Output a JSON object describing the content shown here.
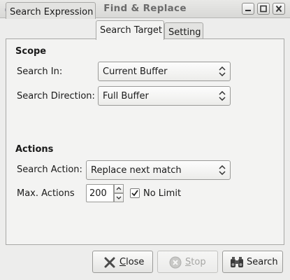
{
  "window": {
    "title": "Find & Replace"
  },
  "tabs": [
    {
      "label": "Search Expression",
      "active": false
    },
    {
      "label": "Search Target",
      "active": true
    },
    {
      "label": "Setting",
      "active": false
    }
  ],
  "scope": {
    "heading": "Scope",
    "search_in_label": "Search In:",
    "search_in_value": "Current Buffer",
    "direction_label": "Search Direction:",
    "direction_value": "Full Buffer"
  },
  "actions": {
    "heading": "Actions",
    "search_action_label": "Search Action:",
    "search_action_value": "Replace next match",
    "max_actions_label": "Max. Actions",
    "max_actions_value": "200",
    "no_limit_label": "No Limit",
    "no_limit_checked": true
  },
  "buttons": {
    "close_rest": "lose",
    "close_mnemonic": "C",
    "stop_rest": "top",
    "stop_mnemonic": "S",
    "stop_enabled": false,
    "search_label": "Search"
  },
  "icons": {
    "app": "app-icon",
    "minimize": "minimize-icon",
    "maximize": "maximize-icon",
    "close": "close-icon",
    "close_button": "x-icon",
    "stop_button": "stop-icon",
    "search_button": "binoculars-icon"
  }
}
